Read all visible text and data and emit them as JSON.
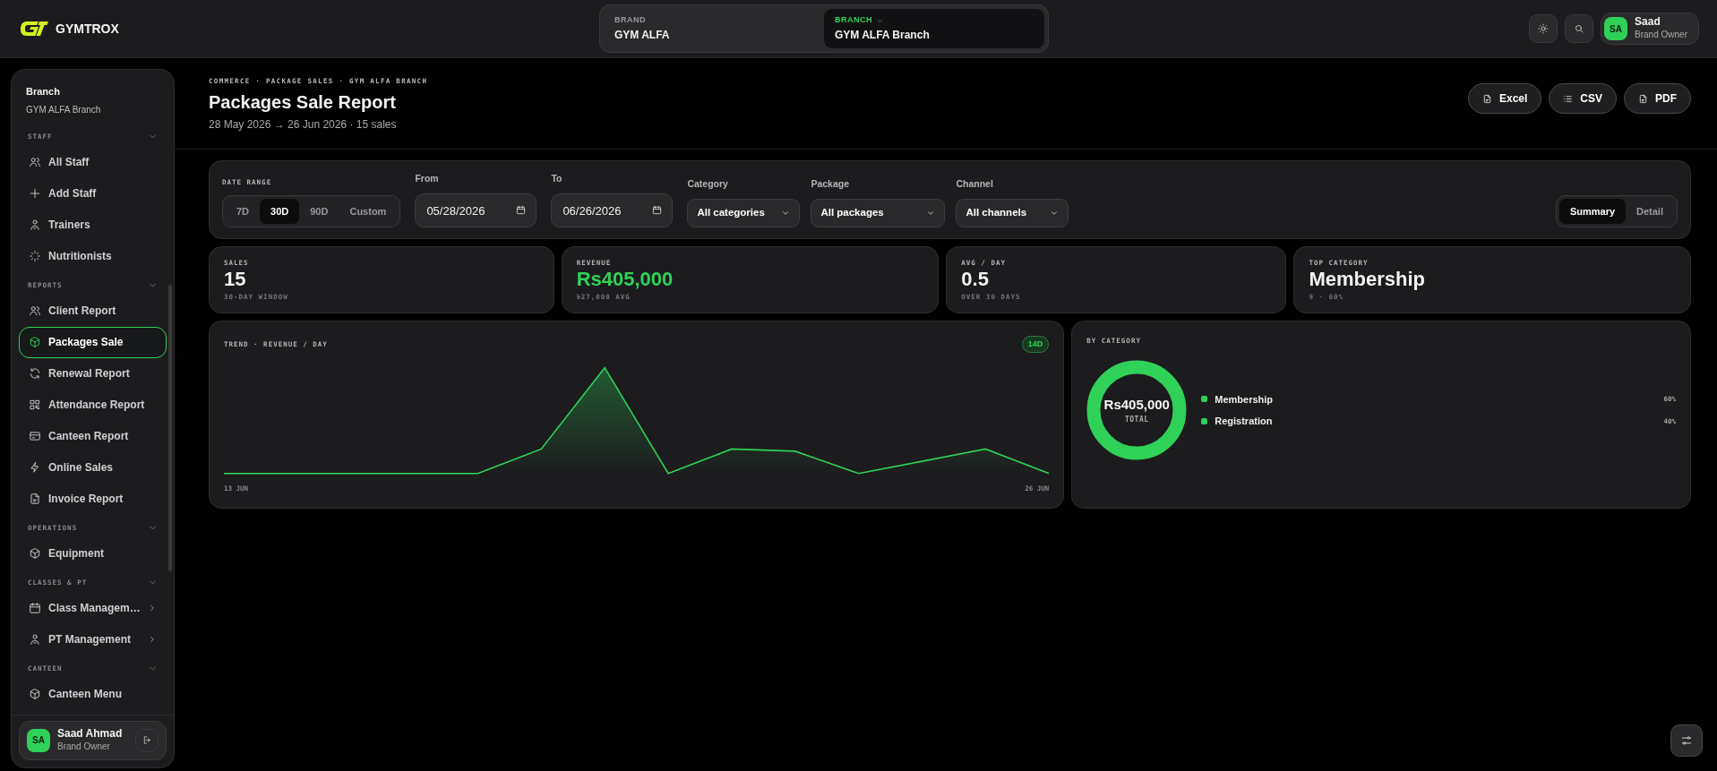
{
  "header": {
    "logo_text": "GYMTROX",
    "switcher": [
      {
        "label": "BRAND",
        "value": "GYM ALFA",
        "selected": false,
        "dropdown": false
      },
      {
        "label": "BRANCH",
        "value": "GYM ALFA Branch",
        "selected": true,
        "dropdown": true
      }
    ],
    "user": {
      "initials": "SA",
      "name": "Saad",
      "role": "Brand Owner"
    }
  },
  "sidebar": {
    "context_label": "Branch",
    "context_value": "GYM ALFA Branch",
    "sections": [
      {
        "title": "STAFF",
        "expanded": true,
        "items": [
          {
            "label": "All Staff",
            "selected": false,
            "submenu": false
          },
          {
            "label": "Add Staff",
            "selected": false,
            "submenu": false
          },
          {
            "label": "Trainers",
            "selected": false,
            "submenu": false
          },
          {
            "label": "Nutritionists",
            "selected": false,
            "submenu": false
          }
        ]
      },
      {
        "title": "REPORTS",
        "expanded": true,
        "items": [
          {
            "label": "Client Report",
            "selected": false,
            "submenu": false
          },
          {
            "label": "Packages Sale",
            "selected": true,
            "submenu": false
          },
          {
            "label": "Renewal Report",
            "selected": false,
            "submenu": false
          },
          {
            "label": "Attendance Report",
            "selected": false,
            "submenu": false
          },
          {
            "label": "Canteen Report",
            "selected": false,
            "submenu": false
          },
          {
            "label": "Online Sales",
            "selected": false,
            "submenu": false
          },
          {
            "label": "Invoice Report",
            "selected": false,
            "submenu": false
          }
        ]
      },
      {
        "title": "OPERATIONS",
        "expanded": true,
        "items": [
          {
            "label": "Equipment",
            "selected": false,
            "submenu": false
          }
        ]
      },
      {
        "title": "CLASSES & PT",
        "expanded": true,
        "items": [
          {
            "label": "Class Managem…",
            "selected": false,
            "submenu": true
          },
          {
            "label": "PT Management",
            "selected": false,
            "submenu": true
          }
        ]
      },
      {
        "title": "CANTEEN",
        "expanded": true,
        "items": [
          {
            "label": "Canteen Menu",
            "selected": false,
            "submenu": false
          }
        ]
      }
    ],
    "footer": {
      "initials": "SA",
      "name": "Saad Ahmad",
      "role": "Brand Owner"
    }
  },
  "page": {
    "breadcrumb": "COMMERCE · PACKAGE SALES · GYM ALFA BRANCH",
    "title": "Packages Sale Report",
    "subtitle": "28 May 2026 → 26 Jun 2026 · 15 sales",
    "exports": [
      "Excel",
      "CSV",
      "PDF"
    ]
  },
  "filters": {
    "date_range": {
      "label": "DATE RANGE",
      "options": [
        {
          "label": "7D",
          "selected": false
        },
        {
          "label": "30D",
          "selected": true
        },
        {
          "label": "90D",
          "selected": false
        },
        {
          "label": "Custom",
          "selected": false
        }
      ]
    },
    "dates": [
      {
        "label": "From",
        "value": "05/28/2026"
      },
      {
        "label": "To",
        "value": "06/26/2026"
      }
    ],
    "selects": [
      {
        "label": "Category",
        "value": "All categories"
      },
      {
        "label": "Package",
        "value": "All packages"
      },
      {
        "label": "Channel",
        "value": "All channels"
      }
    ],
    "view": [
      {
        "label": "Summary",
        "selected": true
      },
      {
        "label": "Detail",
        "selected": false
      }
    ]
  },
  "kpis": [
    {
      "label": "SALES",
      "value": "15",
      "sub": "30-DAY WINDOW",
      "accent": false
    },
    {
      "label": "REVENUE",
      "value": "Rs405,000",
      "sub": "৳27,000 AVG",
      "accent": true
    },
    {
      "label": "AVG / DAY",
      "value": "0.5",
      "sub": "OVER 30 DAYS",
      "accent": false
    },
    {
      "label": "TOP CATEGORY",
      "value": "Membership",
      "sub": "9 · 60%",
      "accent": false
    }
  ],
  "trend": {
    "title": "TREND · REVENUE / DAY",
    "badge": "14D",
    "x_start": "13 JUN",
    "x_end": "26 JUN"
  },
  "by_category": {
    "title": "BY CATEGORY",
    "total": "Rs405,000",
    "total_label": "TOTAL",
    "legend": [
      {
        "label": "Membership",
        "share": "60%"
      },
      {
        "label": "Registration",
        "share": "40%"
      }
    ]
  }
}
